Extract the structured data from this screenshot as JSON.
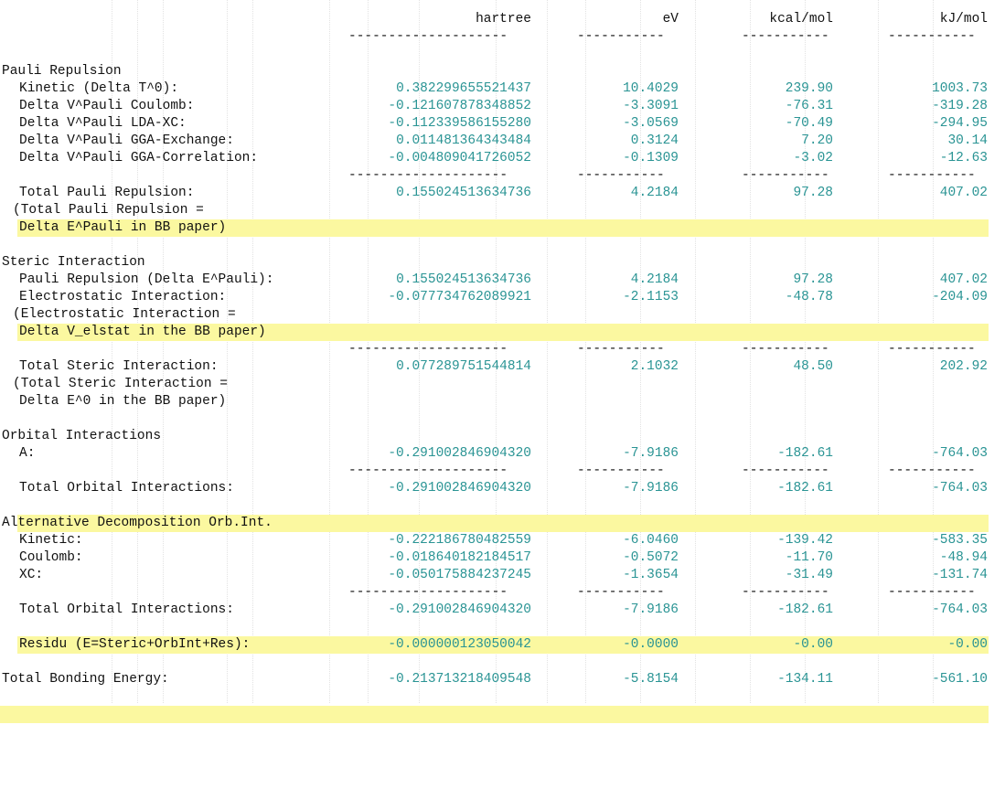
{
  "header": {
    "hartree": "hartree",
    "ev": "eV",
    "kcal": "kcal/mol",
    "kj": "kJ/mol"
  },
  "dashes": {
    "long": "--------------------",
    "short": "-----------"
  },
  "pauli": {
    "title": "Pauli Repulsion",
    "rows": [
      {
        "label": "Kinetic (Delta T^0):",
        "h": "0.382299655521437",
        "ev": "10.4029",
        "kcal": "239.90",
        "kj": "1003.73"
      },
      {
        "label": "Delta V^Pauli Coulomb:",
        "h": "-0.121607878348852",
        "ev": "-3.3091",
        "kcal": "-76.31",
        "kj": "-319.28"
      },
      {
        "label": "Delta V^Pauli LDA-XC:",
        "h": "-0.112339586155280",
        "ev": "-3.0569",
        "kcal": "-70.49",
        "kj": "-294.95"
      },
      {
        "label": "Delta V^Pauli GGA-Exchange:",
        "h": "0.011481364343484",
        "ev": "0.3124",
        "kcal": "7.20",
        "kj": "30.14"
      },
      {
        "label": "Delta V^Pauli GGA-Correlation:",
        "h": "-0.004809041726052",
        "ev": "-0.1309",
        "kcal": "-3.02",
        "kj": "-12.63"
      }
    ],
    "total": {
      "label": "Total Pauli Repulsion:",
      "h": "0.155024513634736",
      "ev": "4.2184",
      "kcal": "97.28",
      "kj": "407.02"
    },
    "note1": "(Total Pauli Repulsion =",
    "note2": "Delta E^Pauli in BB paper)"
  },
  "steric": {
    "title": "Steric Interaction",
    "pauli": {
      "label": "Pauli Repulsion (Delta E^Pauli):",
      "h": "0.155024513634736",
      "ev": "4.2184",
      "kcal": "97.28",
      "kj": "407.02"
    },
    "elstat": {
      "label": "Electrostatic Interaction:",
      "h": "-0.077734762089921",
      "ev": "-2.1153",
      "kcal": "-48.78",
      "kj": "-204.09"
    },
    "note1": "(Electrostatic Interaction =",
    "note2": "Delta V_elstat in the BB paper)",
    "total": {
      "label": "Total Steric Interaction:",
      "h": "0.077289751544814",
      "ev": "2.1032",
      "kcal": "48.50",
      "kj": "202.92"
    },
    "note3": "(Total Steric Interaction =",
    "note4": "Delta E^0 in the BB paper)"
  },
  "orbital": {
    "title": "Orbital Interactions",
    "a": {
      "label": "A:",
      "h": "-0.291002846904320",
      "ev": "-7.9186",
      "kcal": "-182.61",
      "kj": "-764.03"
    },
    "total": {
      "label": "Total Orbital Interactions:",
      "h": "-0.291002846904320",
      "ev": "-7.9186",
      "kcal": "-182.61",
      "kj": "-764.03"
    }
  },
  "alt": {
    "title": "Alternative Decomposition Orb.Int.",
    "rows": [
      {
        "label": "Kinetic:",
        "h": "-0.222186780482559",
        "ev": "-6.0460",
        "kcal": "-139.42",
        "kj": "-583.35"
      },
      {
        "label": "Coulomb:",
        "h": "-0.018640182184517",
        "ev": "-0.5072",
        "kcal": "-11.70",
        "kj": "-48.94"
      },
      {
        "label": "XC:",
        "h": "-0.050175884237245",
        "ev": "-1.3654",
        "kcal": "-31.49",
        "kj": "-131.74"
      }
    ],
    "total": {
      "label": "Total Orbital Interactions:",
      "h": "-0.291002846904320",
      "ev": "-7.9186",
      "kcal": "-182.61",
      "kj": "-764.03"
    }
  },
  "residu": {
    "label": "Residu (E=Steric+OrbInt+Res):",
    "h": "-0.000000123050042",
    "ev": "-0.0000",
    "kcal": "-0.00",
    "kj": "-0.00"
  },
  "bonding": {
    "label": "Total Bonding Energy:",
    "h": "-0.213713218409548",
    "ev": "-5.8154",
    "kcal": "-134.11",
    "kj": "-561.10"
  },
  "colors": {
    "value": "#2a9494",
    "highlight": "#fbf8a0",
    "text": "#111111"
  }
}
